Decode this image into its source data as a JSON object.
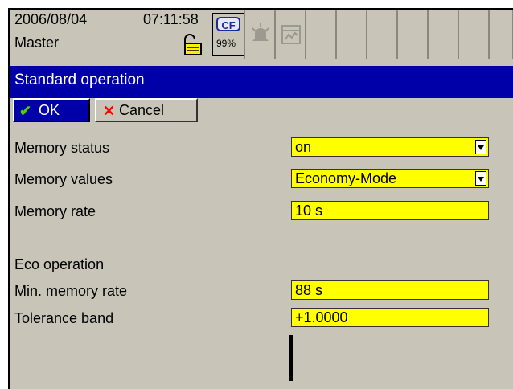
{
  "status": {
    "date": "2006/08/04",
    "time": "07:11:58",
    "user": "Master",
    "cf_label": "CF",
    "cf_percent": "99%"
  },
  "dialog": {
    "title": "Standard operation",
    "ok_label": "OK",
    "cancel_label": "Cancel"
  },
  "settings": {
    "memory_status_label": "Memory status",
    "memory_status_value": "on",
    "memory_values_label": "Memory values",
    "memory_values_value": "Economy-Mode",
    "memory_rate_label": "Memory rate",
    "memory_rate_value": "10 s",
    "eco_heading": "Eco operation",
    "min_memory_rate_label": "Min. memory rate",
    "min_memory_rate_value": "88 s",
    "tolerance_band_label": "Tolerance band",
    "tolerance_band_value": "+1.0000"
  },
  "colors": {
    "titlebar": "#0000a8",
    "field": "#ffff00",
    "panel": "#c8c4b7"
  }
}
